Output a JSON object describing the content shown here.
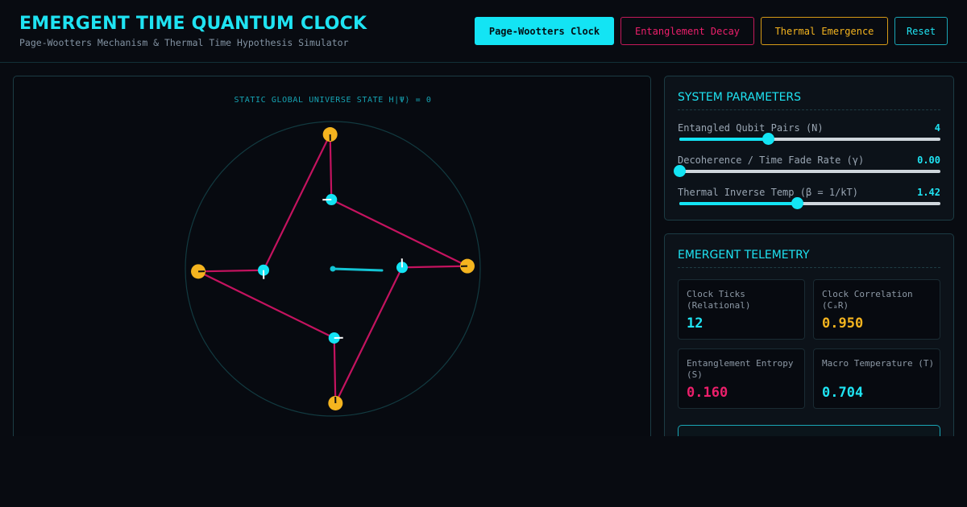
{
  "header": {
    "title": "EMERGENT TIME QUANTUM CLOCK",
    "subtitle": "Page-Wootters Mechanism & Thermal Time Hypothesis Simulator",
    "buttons": {
      "page_wootters": "Page-Wootters Clock",
      "entanglement_decay": "Entanglement Decay",
      "thermal_emergence": "Thermal Emergence",
      "reset": "Reset"
    },
    "active_mode": "page_wootters"
  },
  "canvas": {
    "caption": "STATIC GLOBAL UNIVERSE STATE H|Ψ⟩ = 0",
    "qubit_pairs": 4,
    "colors": {
      "ring": "#123a40",
      "link": "#c4135f",
      "outer": "#f4b41f",
      "inner": "#13e4f4",
      "hand": "#13c4d4"
    }
  },
  "parameters": {
    "title": "SYSTEM PARAMETERS",
    "sliders": [
      {
        "label": "Entangled Qubit Pairs (N)",
        "value": "4",
        "fraction": 0.34
      },
      {
        "label": "Decoherence / Time Fade Rate (γ)",
        "value": "0.00",
        "fraction": 0.0
      },
      {
        "label": "Thermal Inverse Temp (β = 1/kT)",
        "value": "1.42",
        "fraction": 0.45
      }
    ]
  },
  "telemetry": {
    "title": "EMERGENT TELEMETRY",
    "metrics": [
      {
        "label": "Clock Ticks (Relational)",
        "value": "12",
        "color": "cyan"
      },
      {
        "label": "Clock Correlation (CₐR)",
        "value": "0.950",
        "color": "gold"
      },
      {
        "label": "Entanglement Entropy (S)",
        "value": "0.160",
        "color": "pink"
      },
      {
        "label": "Macro Temperature (T)",
        "value": "0.704",
        "color": "cyan"
      }
    ]
  },
  "icons": {
    "reset": "reset-icon"
  }
}
